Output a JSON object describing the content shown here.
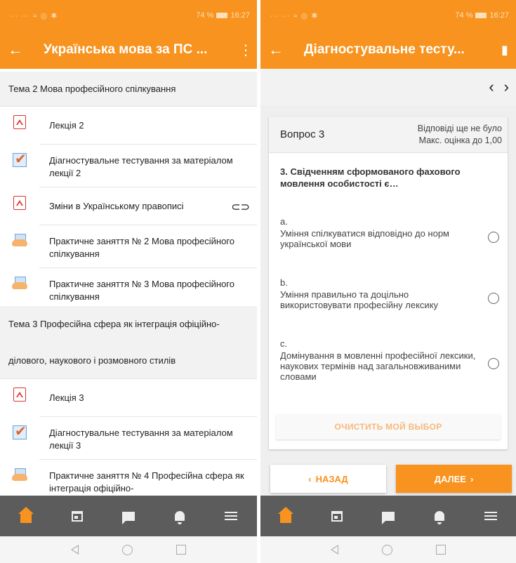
{
  "status": {
    "signal": "∙∙∙ ∙∙∙ ≈ ◎ ✱",
    "battery": "74 %",
    "time": "16:27"
  },
  "left": {
    "title": "Українська мова за ПС ...",
    "section1": "Тема 2 Мова професійного спілкування",
    "items1": [
      {
        "icon": "pdf",
        "label": "Лекція 2"
      },
      {
        "icon": "quiz",
        "label": "Діагностувальне тестування за матеріалом лекції 2"
      },
      {
        "icon": "pdf",
        "label": "Зміни в Українському правописі"
      },
      {
        "icon": "assign",
        "label": "Практичне заняття № 2 Мова професійного спілкування"
      },
      {
        "icon": "assign",
        "label": "Практичне заняття № 3 Мова професійного спілкування"
      }
    ],
    "section2": "Тема 3 Професійна сфера як інтеграція офіційно-ділового, наукового і розмовного стилів",
    "items2": [
      {
        "icon": "pdf",
        "label": "Лекція 3"
      },
      {
        "icon": "quiz",
        "label": "Діагностувальне тестування за матеріалом лекції 3"
      },
      {
        "icon": "assign",
        "label": "Практичне заняття № 4 Професійна сфера як інтеграція офіційно-"
      }
    ]
  },
  "right": {
    "title": "Діагностувальне тесту...",
    "question_label": "Вопрос 3",
    "status_line1": "Відповіді ще не було",
    "status_line2": "Макс. оцінка до 1,00",
    "question_text": "3. Свідченням сформованого фахового мовлення особистості є…",
    "options": [
      {
        "letter": "a.",
        "text": "Уміння спілкуватися відповідно до норм української мови"
      },
      {
        "letter": "b.",
        "text": "Уміння правильно та доцільно використовувати професійну лексику"
      },
      {
        "letter": "c.",
        "text": "Домінування в мовленні професійної лексики, наукових термінів над загальновживаними словами"
      }
    ],
    "clear_label": "ОЧИСТИТЬ МОЙ ВЫБОР",
    "back_label": "НАЗАД",
    "next_label": "ДАЛЕЕ"
  },
  "colors": {
    "accent": "#f7931e",
    "navbar": "#5c5c5c"
  }
}
